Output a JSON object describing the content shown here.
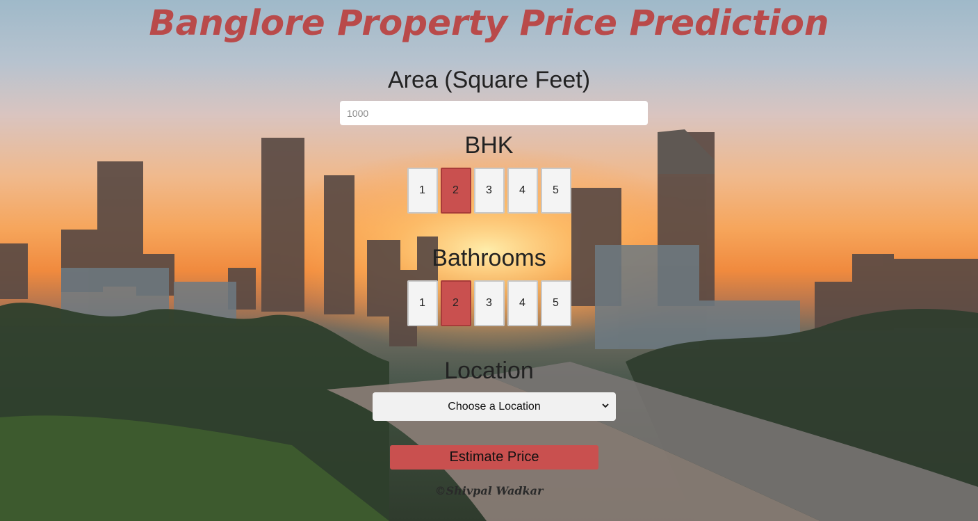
{
  "header": {
    "title": "Banglore Property Price Prediction"
  },
  "area": {
    "label": "Area (Square Feet)",
    "placeholder": "1000",
    "value": ""
  },
  "bhk": {
    "label": "BHK",
    "options": [
      "1",
      "2",
      "3",
      "4",
      "5"
    ],
    "selected": "2"
  },
  "bathrooms": {
    "label": "Bathrooms",
    "options": [
      "1",
      "2",
      "3",
      "4",
      "5"
    ],
    "selected": "2"
  },
  "location": {
    "label": "Location",
    "selected_text": "Choose a Location"
  },
  "actions": {
    "estimate_label": "Estimate Price"
  },
  "footer": {
    "credit": "©Shivpal Wadkar"
  },
  "colors": {
    "accent": "#c9504f",
    "title": "#b94a4a"
  },
  "icons": {
    "select_arrow": "chevron-down-icon"
  }
}
